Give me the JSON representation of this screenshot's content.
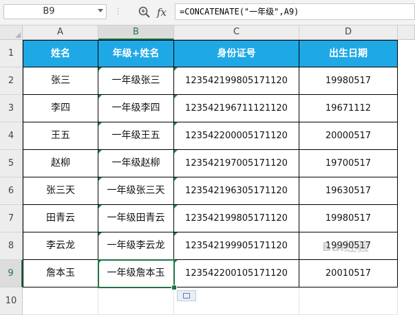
{
  "formula_bar": {
    "name_box": "B9",
    "fx_label": "fx",
    "formula": "=CONCATENATE(\"一年级\",A9)"
  },
  "columns": [
    "A",
    "B",
    "C",
    "D"
  ],
  "rows": [
    "1",
    "2",
    "3",
    "4",
    "5",
    "6",
    "7",
    "8",
    "9",
    "10"
  ],
  "header": [
    "姓名",
    "年级+姓名",
    "身份证号",
    "出生日期"
  ],
  "data": [
    [
      "张三",
      "一年级张三",
      "123542199805171120",
      "19980517"
    ],
    [
      "李四",
      "一年级李四",
      "123542196711121120",
      "19671112"
    ],
    [
      "王五",
      "一年级王五",
      "123542200005171120",
      "20000517"
    ],
    [
      "赵柳",
      "一年级赵柳",
      "123542197005171120",
      "19700517"
    ],
    [
      "张三天",
      "一年级张三天",
      "123542196305171120",
      "19630517"
    ],
    [
      "田青云",
      "一年级田青云",
      "123542199805171120",
      "19980517"
    ],
    [
      "李云龙",
      "一年级李云龙",
      "123542199905171120",
      "19990517"
    ],
    [
      "詹本玉",
      "一年级詹本玉",
      "123542200105171120",
      "20010517"
    ]
  ],
  "colors": {
    "header_fill": "#1fa8e6",
    "selection": "#217346"
  },
  "watermark": "Bai经验"
}
